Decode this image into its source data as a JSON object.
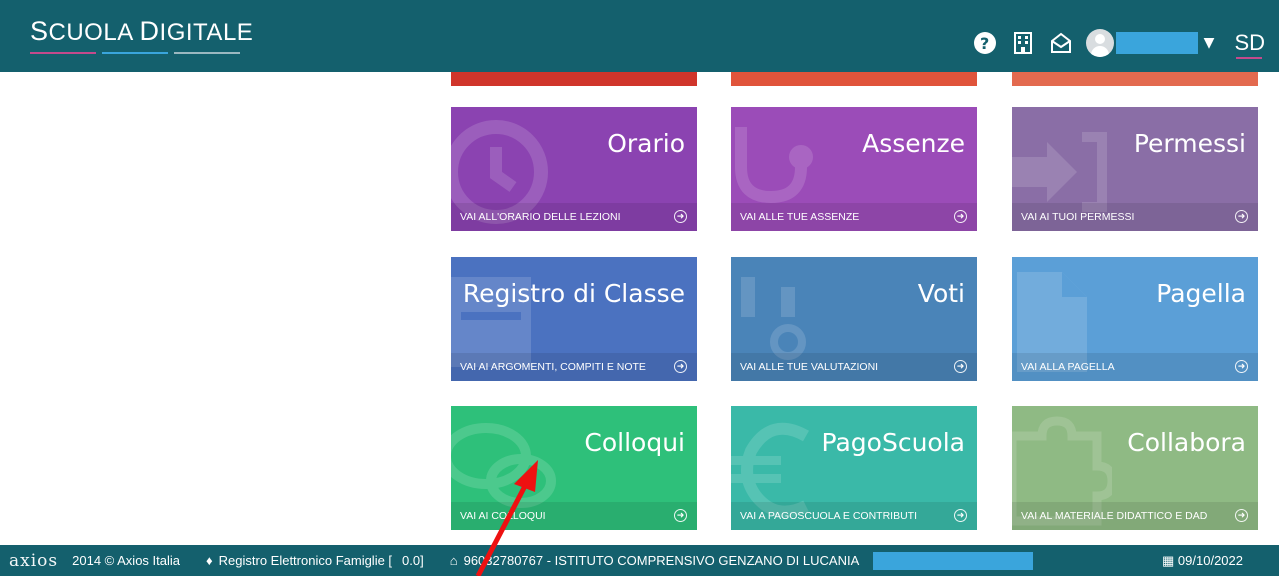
{
  "header": {
    "brand_first_big": "S",
    "brand_first_rest": "CUOLA ",
    "brand_second_big": "D",
    "brand_second_rest": "IGITALE",
    "brand_line_colors": [
      "#c44a8c",
      "#3aa5dc",
      "#9bb8c0"
    ],
    "help_glyph": "?",
    "building_icon": "building-icon",
    "mail_icon": "envelope-open-icon",
    "user_menu_chevron": "⌄",
    "sd_logo": "SD",
    "accent": "#14606d"
  },
  "top_partial_tiles": [
    "#d0352b",
    "#e0543b",
    "#e36a4f"
  ],
  "tiles": [
    {
      "title": "Orario",
      "footer": "VAI ALL'ORARIO DELLE LEZIONI",
      "color": "#8b43b1",
      "icon": "clock-icon"
    },
    {
      "title": "Assenze",
      "footer": "VAI ALLE TUE ASSENZE",
      "color": "#9b4cb8",
      "icon": "stethoscope-icon"
    },
    {
      "title": "Permessi",
      "footer": "VAI AI TUOI PERMESSI",
      "color": "#8a6ea6",
      "icon": "sign-in-icon"
    },
    {
      "title": "Registro di Classe",
      "footer": "VAI AI ARGOMENTI, COMPITI E NOTE",
      "color": "#4b72c0",
      "icon": "book-icon"
    },
    {
      "title": "Voti",
      "footer": "VAI ALLE TUE VALUTAZIONI",
      "color": "#4a84b8",
      "icon": "grades-icon"
    },
    {
      "title": "Pagella",
      "footer": "VAI ALLA PAGELLA",
      "color": "#5b9fd7",
      "icon": "document-icon"
    },
    {
      "title": "Colloqui",
      "footer": "VAI AI COLLOQUI",
      "color": "#2ec07a",
      "icon": "chat-icon"
    },
    {
      "title": "PagoScuola",
      "footer": "VAI A PAGOSCUOLA E CONTRIBUTI",
      "color": "#3ab9a8",
      "icon": "euro-icon"
    },
    {
      "title": "Collabora",
      "footer": "VAI AL MATERIALE DIDATTICO E DAD",
      "color": "#8fba84",
      "icon": "puzzle-icon"
    }
  ],
  "footer": {
    "logo": "axios",
    "copyright": "2014 © Axios Italia",
    "product": "Registro Elettronico Famiglie [",
    "version": "0.0]",
    "school": "96032780767 - ISTITUTO COMPRENSIVO GENZANO DI LUCANIA",
    "date": "09/10/2022"
  }
}
